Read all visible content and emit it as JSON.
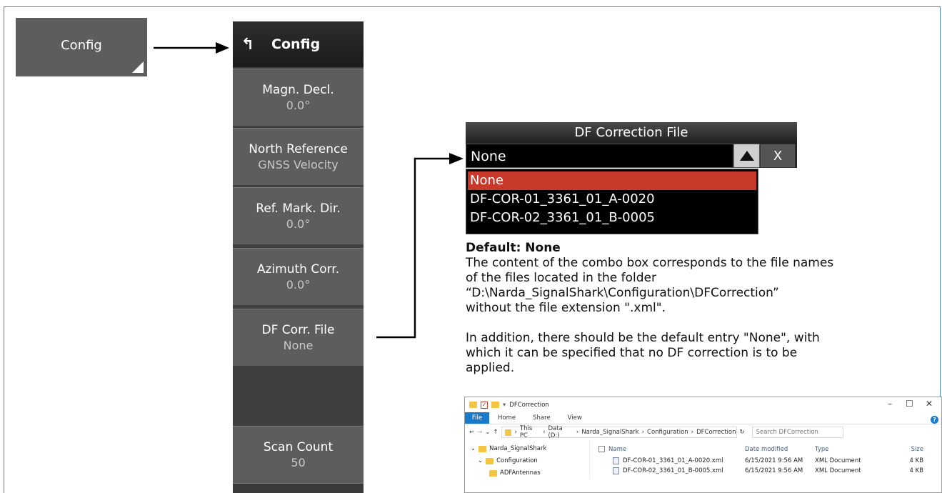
{
  "config_key": {
    "label": "Config"
  },
  "menu": {
    "title": "Config",
    "back_icon": "back-arrow-icon",
    "items": [
      {
        "label": "Magn. Decl.",
        "value": "0.0°"
      },
      {
        "label": "North Reference",
        "value": "GNSS Velocity"
      },
      {
        "label": "Ref. Mark. Dir.",
        "value": "0.0°"
      },
      {
        "label": "Azimuth Corr.",
        "value": "0.0°"
      },
      {
        "label": "DF Corr. File",
        "value": "None"
      }
    ],
    "scan_count": {
      "label": "Scan Count",
      "value": "50"
    }
  },
  "df_correction": {
    "title": "DF Correction File",
    "current": "None",
    "close_label": "X",
    "options": [
      "None",
      "DF-COR-01_3361_01_A-0020",
      "DF-COR-02_3361_01_B-0005"
    ],
    "selected_index": 0
  },
  "description": {
    "default_heading": "Default: None",
    "lines": [
      "The content of the combo box corresponds to the file names",
      "of the files located in the folder",
      "“D:\\Narda_SignalShark\\Configuration\\DFCorrection”",
      "without the file extension \".xml\"."
    ],
    "lines2": [
      "In addition, there should be the default entry \"None\", with",
      "which it can be specified that no DF correction is to be",
      "applied."
    ]
  },
  "explorer": {
    "window_title": "DFCorrection",
    "ribbon_tabs": [
      "File",
      "Home",
      "Share",
      "View"
    ],
    "path": [
      "This PC",
      "Data (D:)",
      "Narda_SignalShark",
      "Configuration",
      "DFCorrection"
    ],
    "search_placeholder": "Search DFCorrection",
    "tree": [
      "Narda_SignalShark",
      "Configuration",
      "ADFAntennas"
    ],
    "columns": [
      "Name",
      "Date modified",
      "Type",
      "Size"
    ],
    "files": [
      {
        "name": "DF-COR-01_3361_01_A-0020.xml",
        "date": "6/15/2021 9:56 AM",
        "type": "XML Document",
        "size": "4 KB"
      },
      {
        "name": "DF-COR-02_3361_01_B-0005.xml",
        "date": "6/15/2021 9:56 AM",
        "type": "XML Document",
        "size": "4 KB"
      }
    ]
  },
  "colors": {
    "selected": "#c8392b",
    "softkey": "#5d5d5d",
    "frame": "#4f7ec2",
    "file_tab": "#1979ca"
  }
}
